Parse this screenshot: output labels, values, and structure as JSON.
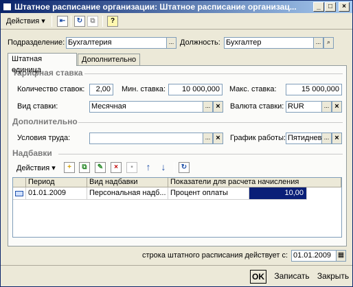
{
  "window": {
    "title": "Штатное расписание организации: Штатное расписание организац..."
  },
  "toolbar": {
    "actions_label": "Действия",
    "help_label": "?"
  },
  "header": {
    "department_label": "Подразделение:",
    "department_value": "Бухгалтерия",
    "position_label": "Должность:",
    "position_value": "Бухгалтер"
  },
  "tabs": [
    {
      "label": "Штатная единица",
      "active": true
    },
    {
      "label": "Дополнительно",
      "active": false
    }
  ],
  "tariff": {
    "section_title": "Тарифная ставка",
    "rate_count_label": "Количество ставок:",
    "rate_count_value": "2,00",
    "min_rate_label": "Мин. ставка:",
    "min_rate_value": "10 000,000",
    "max_rate_label": "Макс. ставка:",
    "max_rate_value": "15 000,000",
    "rate_type_label": "Вид ставки:",
    "rate_type_value": "Месячная",
    "currency_label": "Валюта ставки:",
    "currency_value": "RUR"
  },
  "additional": {
    "section_title": "Дополнительно",
    "work_conditions_label": "Условия труда:",
    "work_conditions_value": "",
    "schedule_label": "График работы:",
    "schedule_value": "Пятиднев"
  },
  "allowances": {
    "section_title": "Надбавки",
    "actions_label": "Действия",
    "columns": [
      "Период",
      "Вид надбавки",
      "Показатели для расчета начисления"
    ],
    "rows": [
      {
        "period": "01.01.2009",
        "type": "Персональная надб...",
        "indicator": "Процент оплаты",
        "value": "10,00"
      }
    ]
  },
  "footer": {
    "effective_label": "строка штатного расписания действует с:",
    "effective_date": "01.01.2009",
    "ok_label": "OK",
    "save_label": "Записать",
    "close_label": "Закрыть"
  }
}
